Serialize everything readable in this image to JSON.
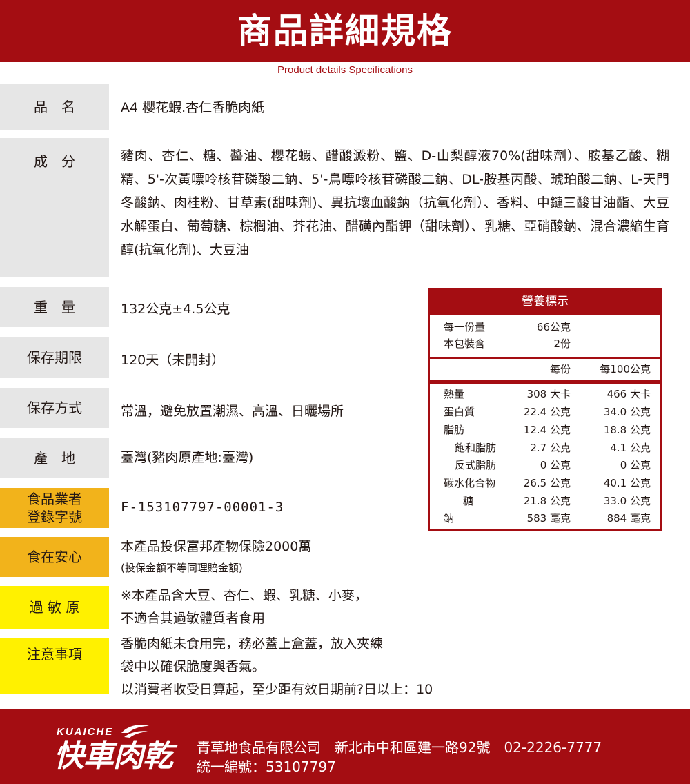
{
  "header": {
    "title": "商品詳細規格",
    "subtitle": "Product details Specifications"
  },
  "rows": {
    "name": {
      "label": "品　名",
      "value": "A4 櫻花蝦.杏仁香脆肉紙"
    },
    "ingredients": {
      "label": "成　分",
      "value": "豬肉、杏仁、糖、醬油、櫻花蝦、醋酸澱粉、鹽、D-山梨醇液70%(甜味劑）、胺基乙酸、糊精、5'-次黃嘌呤核苷磷酸二鈉、5'-鳥嘌呤核苷磷酸二鈉、DL-胺基丙酸、琥珀酸二鈉、L-天門冬酸鈉、肉桂粉、甘草素(甜味劑)、異抗壞血酸鈉（抗氧化劑）、香料、中鏈三酸甘油酯、大豆水解蛋白、葡萄糖、棕櫚油、芥花油、醋磺內酯鉀（甜味劑）、乳糖、亞硝酸鈉、混合濃縮生育醇(抗氧化劑)、大豆油"
    },
    "weight": {
      "label": "重　量",
      "value": "132公克±4.5公克"
    },
    "shelf_life": {
      "label": "保存期限",
      "value": "120天（未開封）"
    },
    "storage": {
      "label": "保存方式",
      "value": "常溫，避免放置潮濕、高溫、日曬場所"
    },
    "origin": {
      "label": "產　地",
      "value": "臺灣(豬肉原產地:臺灣)"
    },
    "registration": {
      "label_line1": "食品業者",
      "label_line2": "登錄字號",
      "value": "F-153107797-00001-3"
    },
    "insurance": {
      "label": "食在安心",
      "value": "本產品投保富邦產物保險2000萬",
      "note": "(投保金額不等同理賠金額)"
    },
    "allergen": {
      "label": "過 敏 原",
      "line1": "※本產品含大豆、杏仁、蝦、乳糖、小麥，",
      "line2": "不適合其過敏體質者食用"
    },
    "notice": {
      "label": "注意事項",
      "line1": "香脆肉紙未食用完，務必蓋上盒蓋，放入夾練",
      "line2": "袋中以確保脆度與香氣。",
      "line3": "以消費者收受日算起，至少距有效日期前?日以上：10"
    }
  },
  "nutrition": {
    "title": "營養標示",
    "serving_size_label": "每一份量",
    "serving_size_value": "66公克",
    "servings_label": "本包裝含",
    "servings_value": "2份",
    "col_per_serving": "每份",
    "col_per_100g": "每100公克",
    "items": [
      {
        "name": "熱量",
        "per_serving": "308 大卡",
        "per_100g": "466 大卡"
      },
      {
        "name": "蛋白質",
        "per_serving": "22.4 公克",
        "per_100g": "34.0 公克"
      },
      {
        "name": "脂肪",
        "per_serving": "12.4 公克",
        "per_100g": "18.8 公克"
      },
      {
        "name": "飽和脂肪",
        "per_serving": "2.7 公克",
        "per_100g": "4.1 公克"
      },
      {
        "name": "反式脂肪",
        "per_serving": "0 公克",
        "per_100g": "0 公克"
      },
      {
        "name": "碳水化合物",
        "per_serving": "26.5 公克",
        "per_100g": "40.1 公克"
      },
      {
        "name": "糖",
        "per_serving": "21.8 公克",
        "per_100g": "33.0 公克"
      },
      {
        "name": "鈉",
        "per_serving": "583 毫克",
        "per_100g": "884 毫克"
      }
    ]
  },
  "footer": {
    "logo_small": "KUAICHE",
    "logo_big": "快車肉乾",
    "company_line1": "青草地食品有限公司　新北市中和區建一路92號　02-2226-7777",
    "company_line2": "統一編號：53107797"
  },
  "colors": {
    "brand_red": "#a40d12",
    "label_gray": "#e6e6e6",
    "label_orange": "#f2b31b",
    "label_yellow": "#fff100"
  }
}
